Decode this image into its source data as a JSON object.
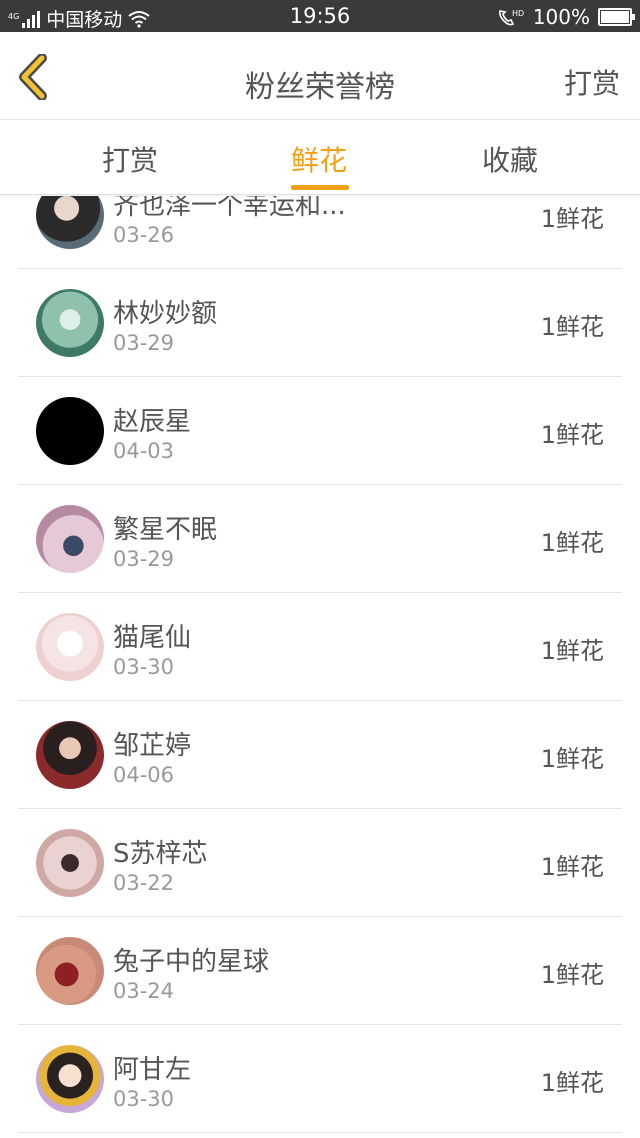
{
  "status_bar": {
    "network_tag": "4G",
    "carrier": "中国移动",
    "time": "19:56",
    "battery": "100%",
    "icons": [
      "signal-icon",
      "wifi-icon",
      "hd-call-icon",
      "battery-icon"
    ]
  },
  "header": {
    "back_icon": "chevron-left-icon",
    "title": "粉丝荣誉榜",
    "action": "打赏"
  },
  "tabs": [
    {
      "label": "打赏",
      "active": false
    },
    {
      "label": "鲜花",
      "active": true
    },
    {
      "label": "收藏",
      "active": false
    }
  ],
  "colors": {
    "accent": "#f2a116",
    "text": "#555555",
    "subtext": "#999999",
    "statusbar": "#3a3a3a"
  },
  "fans": [
    {
      "name": "齐也泽一个幸运和...",
      "date": "03-26",
      "amount": "1鲜花"
    },
    {
      "name": "林妙妙额",
      "date": "03-29",
      "amount": "1鲜花"
    },
    {
      "name": "赵辰星",
      "date": "04-03",
      "amount": "1鲜花"
    },
    {
      "name": "繁星不眠",
      "date": "03-29",
      "amount": "1鲜花"
    },
    {
      "name": "猫尾仙",
      "date": "03-30",
      "amount": "1鲜花"
    },
    {
      "name": "邹芷婷",
      "date": "04-06",
      "amount": "1鲜花"
    },
    {
      "name": "S苏梓芯",
      "date": "03-22",
      "amount": "1鲜花"
    },
    {
      "name": "兔子中的星球",
      "date": "03-24",
      "amount": "1鲜花"
    },
    {
      "name": "阿甘左",
      "date": "03-30",
      "amount": "1鲜花"
    }
  ]
}
